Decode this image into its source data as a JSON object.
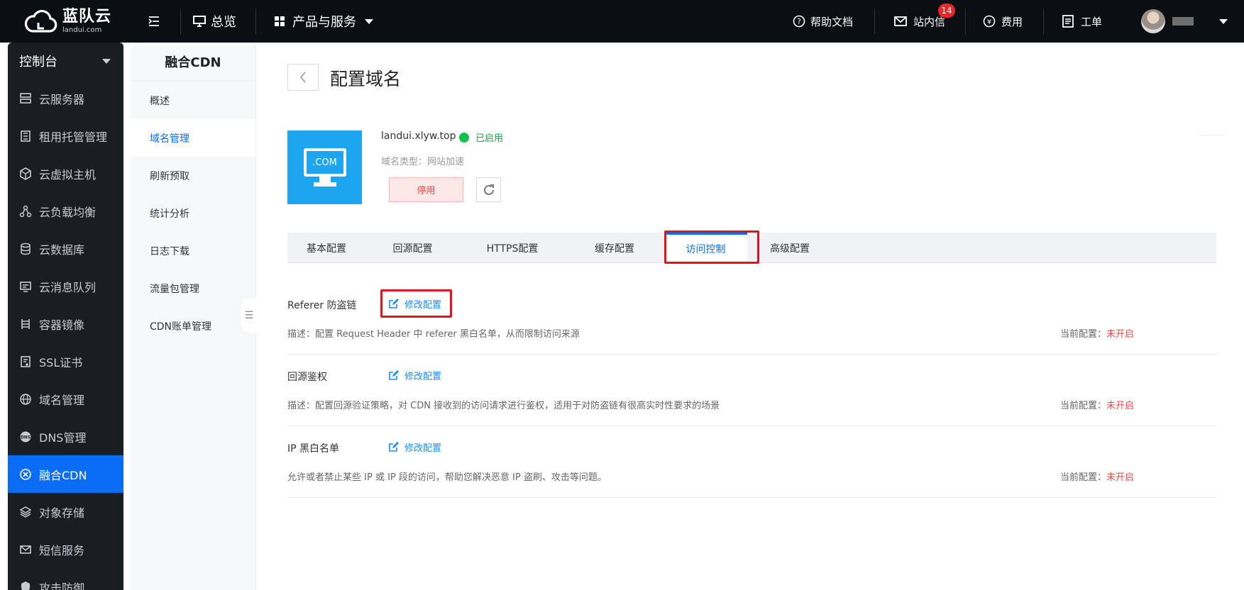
{
  "topbar": {
    "brand": "蓝队云",
    "brand_sub": "landui.com",
    "overview": "总览",
    "products": "产品与服务",
    "help": "帮助文档",
    "messages": "站内信",
    "messages_badge": "14",
    "fees": "费用",
    "tickets": "工单"
  },
  "sidebar": {
    "header": "控制台",
    "items": [
      {
        "label": "云服务器",
        "icon": "server-icon"
      },
      {
        "label": "租用托管管理",
        "icon": "rack-icon"
      },
      {
        "label": "云虚拟主机",
        "icon": "cube-icon"
      },
      {
        "label": "云负载均衡",
        "icon": "balance-icon"
      },
      {
        "label": "云数据库",
        "icon": "database-icon"
      },
      {
        "label": "云消息队列",
        "icon": "queue-icon"
      },
      {
        "label": "容器镜像",
        "icon": "container-icon"
      },
      {
        "label": "SSL证书",
        "icon": "certificate-icon"
      },
      {
        "label": "域名管理",
        "icon": "globe-icon"
      },
      {
        "label": "DNS管理",
        "icon": "dns-icon"
      },
      {
        "label": "融合CDN",
        "icon": "cdn-icon"
      },
      {
        "label": "对象存储",
        "icon": "layers-icon"
      },
      {
        "label": "短信服务",
        "icon": "mail-icon"
      },
      {
        "label": "攻击防御",
        "icon": "shield-icon"
      }
    ],
    "active_index": 10
  },
  "subnav": {
    "title": "融合CDN",
    "items": [
      "概述",
      "域名管理",
      "刷新预取",
      "统计分析",
      "日志下载",
      "流量包管理",
      "CDN账单管理"
    ],
    "active_index": 1
  },
  "page": {
    "title": "配置域名",
    "domain": "landui.xlyw.top",
    "status": "已启用",
    "domain_type": "域名类型：网站加速",
    "icon_text": ".COM",
    "stop_button": "停用",
    "tabs": [
      "基本配置",
      "回源配置",
      "HTTPS配置",
      "缓存配置",
      "访问控制",
      "高级配置"
    ],
    "active_tab": 4
  },
  "sections": [
    {
      "title": "Referer 防盗链",
      "edit": "修改配置",
      "desc": "描述：配置 Request Header 中 referer 黑白名单，从而限制访问来源",
      "current_label": "当前配置：",
      "current_value": "未开启"
    },
    {
      "title": "回源鉴权",
      "edit": "修改配置",
      "desc": "描述：配置回源验证策略，对 CDN 接收到的访问请求进行鉴权，适用于对防盗链有很高实时性要求的场景",
      "current_label": "当前配置：",
      "current_value": "未开启"
    },
    {
      "title": "IP 黑白名单",
      "edit": "修改配置",
      "desc": "允许或者禁止某些 IP 或 IP 段的访问，帮助您解决恶意 IP 盗刷、攻击等问题。",
      "current_label": "当前配置：",
      "current_value": "未开启"
    }
  ],
  "colors": {
    "accent": "#0b6cf5",
    "danger": "#f04848",
    "success": "#12c04a",
    "highlight_box": "#e0141c"
  }
}
